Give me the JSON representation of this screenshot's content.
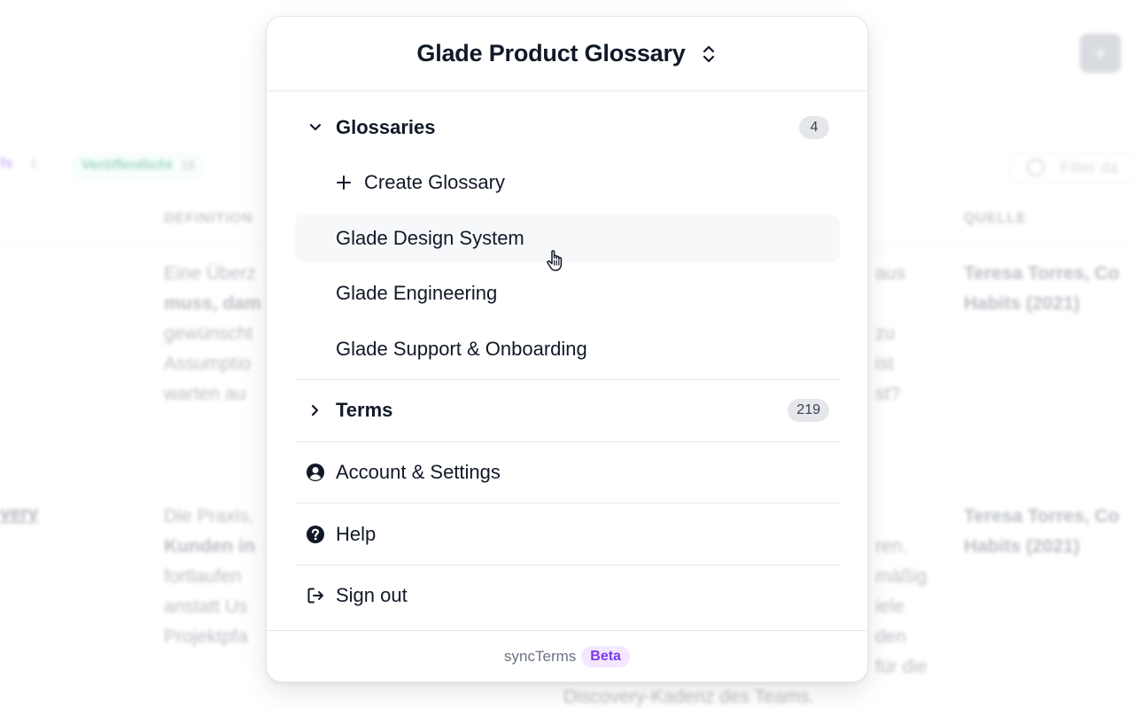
{
  "background": {
    "add_button": "+",
    "filter_a_label": "fs",
    "filter_a_count": "1",
    "filter_b_label": "Veröffentlicht",
    "filter_b_count": "18",
    "search_placeholder": "Filter da",
    "col_definition": "DEFINITION",
    "col_source": "QUELLE",
    "row1_def": "Eine Überz",
    "row1_def_2": "muss, dam",
    "row1_def_3": "gewünscht",
    "row1_def_4": "Assumptio",
    "row1_def_5": "warten au",
    "row1_right_1": "aus",
    "row1_right_2": "zu",
    "row1_right_3": "ist",
    "row1_right_4": "st?",
    "row1_source_1": "Teresa Torres, Co",
    "row1_source_2": "Habits (2021)",
    "row2_term": "very",
    "row2_def_1": "Die Praxis,",
    "row2_def_2": "Kunden in",
    "row2_def_3": "fortlaufen",
    "row2_def_4": "anstatt Us",
    "row2_def_5": "Projektpfa",
    "row2_right_1": "ren.",
    "row2_right_2": "mäßig",
    "row2_right_3": "iele",
    "row2_right_4": "den",
    "row2_right_5": "für die",
    "row2_right_6": "Discovery-Kadenz des Teams.",
    "row2_source_1": "Teresa Torres, Co",
    "row2_source_2": "Habits (2021)"
  },
  "menu": {
    "title": "Glade Product Glossary",
    "glossaries_label": "Glossaries",
    "glossaries_count": "4",
    "create_label": "Create Glossary",
    "glossary_items": [
      "Glade Design System",
      "Glade Engineering",
      "Glade Support & Onboarding"
    ],
    "terms_label": "Terms",
    "terms_count": "219",
    "account_label": "Account & Settings",
    "help_label": "Help",
    "signout_label": "Sign out"
  },
  "footer": {
    "brand": "syncTerms",
    "badge": "Beta"
  },
  "colors": {
    "accent": "#7c3aed",
    "badge_bg": "#e5e7eb",
    "hover_bg": "#f7f8fa"
  },
  "icons": [
    "updown-chevron-icon",
    "chevron-down-icon",
    "plus-icon",
    "chevron-right-icon",
    "user-circle-icon",
    "question-circle-icon",
    "sign-out-icon",
    "hand-pointer-icon"
  ]
}
